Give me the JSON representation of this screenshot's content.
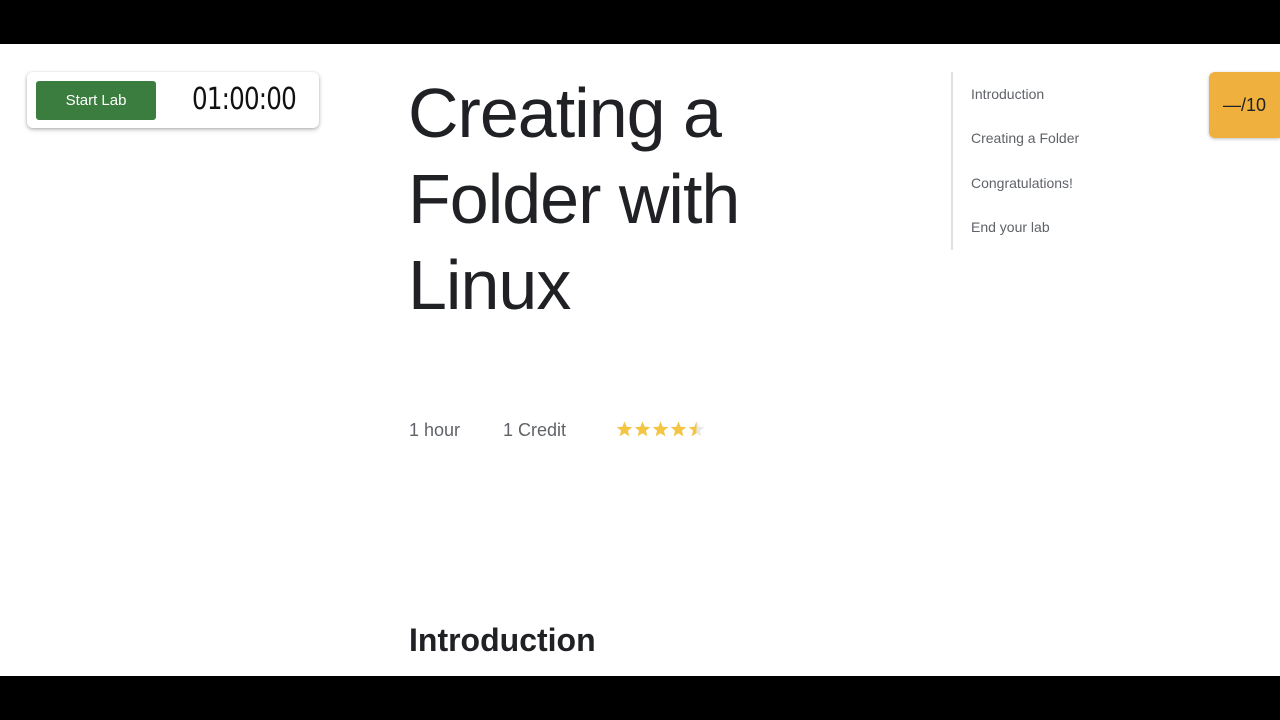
{
  "lab_control": {
    "start_label": "Start Lab",
    "timer": "01:00:00"
  },
  "title": {
    "line1": "Creating a",
    "line2": "Folder with",
    "line3": "Linux"
  },
  "meta": {
    "duration": "1 hour",
    "credits": "1 Credit",
    "rating": 4.5,
    "rating_max": 5,
    "star_color": "#f4c542"
  },
  "toc": {
    "items": [
      {
        "label": "Introduction"
      },
      {
        "label": "Creating a Folder"
      },
      {
        "label": "Congratulations!"
      },
      {
        "label": "End your lab"
      }
    ]
  },
  "score": {
    "label": "—/10"
  },
  "main": {
    "section_heading": "Introduction"
  },
  "colors": {
    "accent_green": "#3b7d3f",
    "score_orange": "#f0b03e"
  }
}
